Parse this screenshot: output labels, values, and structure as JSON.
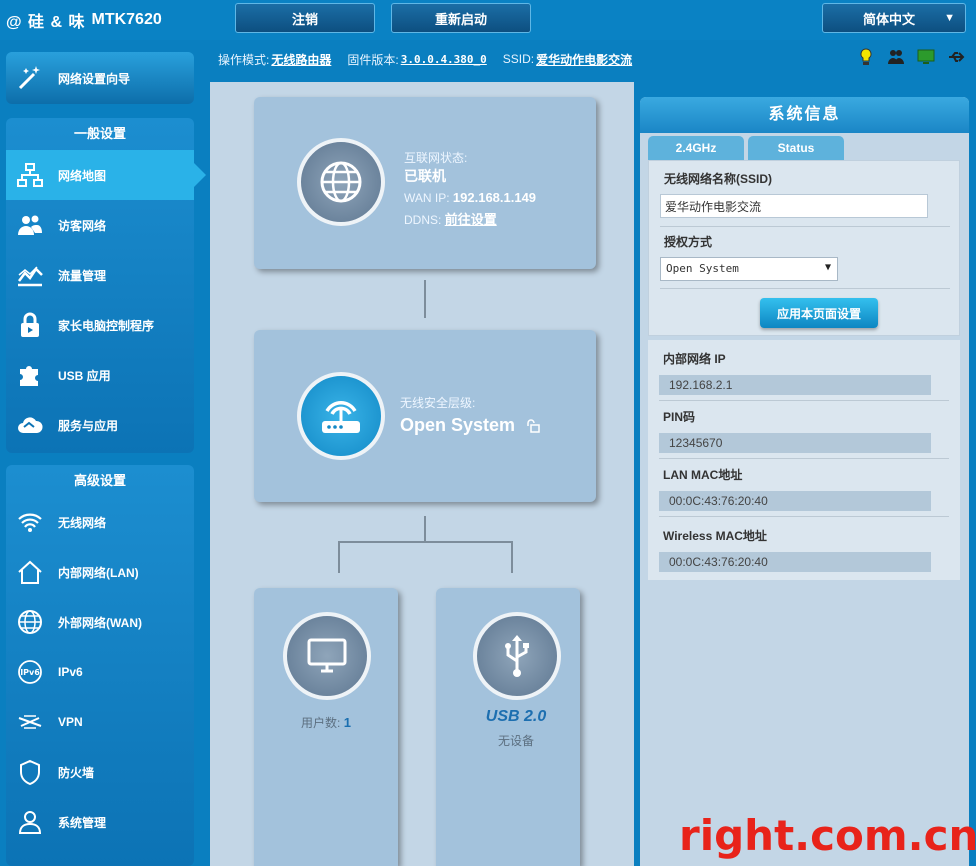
{
  "header": {
    "logo_mark": "@ 硅 & 味",
    "model": "MTK7620",
    "logout_label": "注销",
    "reboot_label": "重新启动",
    "language": "简体中文"
  },
  "infobar": {
    "mode_label": "操作模式:",
    "mode_value": "无线路由器",
    "firmware_label": "固件版本:",
    "firmware_value": "3.0.0.4.380_0",
    "ssid_label": "SSID:",
    "ssid_value": "爱华动作电影交流"
  },
  "sidebar": {
    "wizard_label": "网络设置向导",
    "general_title": "一般设置",
    "general_items": [
      {
        "label": "网络地图",
        "icon": "network-map-icon"
      },
      {
        "label": "访客网络",
        "icon": "guest-network-icon"
      },
      {
        "label": "流量管理",
        "icon": "traffic-icon"
      },
      {
        "label": "家长电脑控制程序",
        "icon": "parental-lock-icon"
      },
      {
        "label": "USB 应用",
        "icon": "puzzle-icon"
      },
      {
        "label": "服务与应用",
        "icon": "cloud-icon"
      }
    ],
    "advanced_title": "高级设置",
    "advanced_items": [
      {
        "label": "无线网络",
        "icon": "wifi-icon"
      },
      {
        "label": "内部网络(LAN)",
        "icon": "home-icon"
      },
      {
        "label": "外部网络(WAN)",
        "icon": "globe-icon"
      },
      {
        "label": "IPv6",
        "icon": "ipv6-icon"
      },
      {
        "label": "VPN",
        "icon": "vpn-icon"
      },
      {
        "label": "防火墙",
        "icon": "shield-icon"
      },
      {
        "label": "系统管理",
        "icon": "user-icon"
      }
    ]
  },
  "map": {
    "internet_status_label": "互联网状态:",
    "internet_status_value": "已联机",
    "wan_ip_label": "WAN IP:",
    "wan_ip_value": "192.168.1.149",
    "ddns_label": "DDNS:",
    "ddns_link": "前往设置",
    "security_label": "无线安全层级:",
    "security_value": "Open System",
    "clients_label": "用户数:",
    "clients_value": "1",
    "usb_title": "USB 2.0",
    "usb_status": "无设备"
  },
  "sysinfo": {
    "title": "系统信息",
    "tabs": [
      "2.4GHz",
      "Status"
    ],
    "ssid_label": "无线网络名称(SSID)",
    "ssid_value": "爱华动作电影交流",
    "auth_label": "授权方式",
    "auth_value": "Open System",
    "apply_label": "应用本页面设置",
    "lan_ip_label": "内部网络 IP",
    "lan_ip_value": "192.168.2.1",
    "pin_label": "PIN码",
    "pin_value": "12345670",
    "lan_mac_label": "LAN MAC地址",
    "lan_mac_value": "00:0C:43:76:20:40",
    "wl_mac_label": "Wireless MAC地址",
    "wl_mac_value": "00:0C:43:76:20:40"
  },
  "watermark": "right.com.cn"
}
